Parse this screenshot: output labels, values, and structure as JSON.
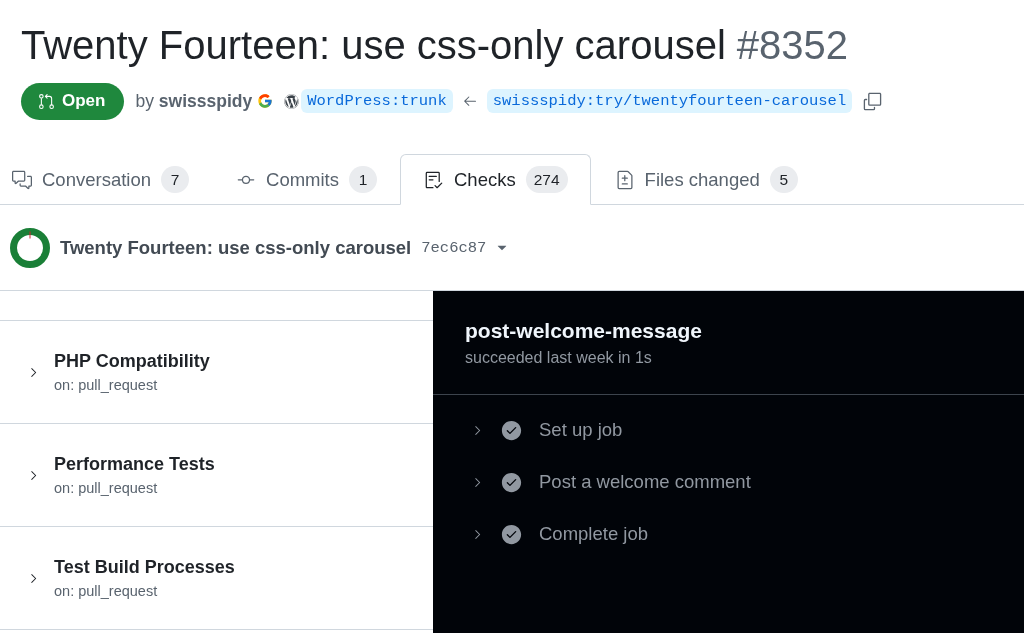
{
  "title": {
    "text": "Twenty Fourteen: use css-only carousel",
    "number": "#8352"
  },
  "meta": {
    "state": {
      "label": "Open",
      "kind": "open"
    },
    "byline": "by **swissspidy**",
    "base_branch": "WordPress:trunk",
    "head_branch": "swissspidy:try/twentyfourteen-carousel"
  },
  "tabs": [
    {
      "label": "Conversation",
      "count": "7",
      "kind": "conversation",
      "selected": false
    },
    {
      "label": "Commits",
      "count": "1",
      "kind": "commits",
      "selected": false
    },
    {
      "label": "Checks",
      "count": "274",
      "kind": "checks",
      "selected": true
    },
    {
      "label": "Files changed",
      "count": "5",
      "kind": "files",
      "selected": false
    }
  ],
  "commit": {
    "title": "Twenty Fourteen: use css-only carousel",
    "sha": "7ec6c87"
  },
  "workflows": [
    {
      "name": "PHP Compatibility",
      "trigger": "on: pull_request",
      "expanded": false
    },
    {
      "name": "Performance Tests",
      "trigger": "on: pull_request",
      "expanded": false
    },
    {
      "name": "Test Build Processes",
      "trigger": "on: pull_request",
      "expanded": false
    }
  ],
  "job": {
    "name": "post-welcome-message",
    "summary": "succeeded last week in 1s",
    "steps": [
      {
        "name": "Set up job",
        "kind": "success",
        "expanded": false
      },
      {
        "name": "Post a welcome comment",
        "kind": "success",
        "expanded": false
      },
      {
        "name": "Complete job",
        "kind": "success",
        "expanded": false
      }
    ]
  }
}
